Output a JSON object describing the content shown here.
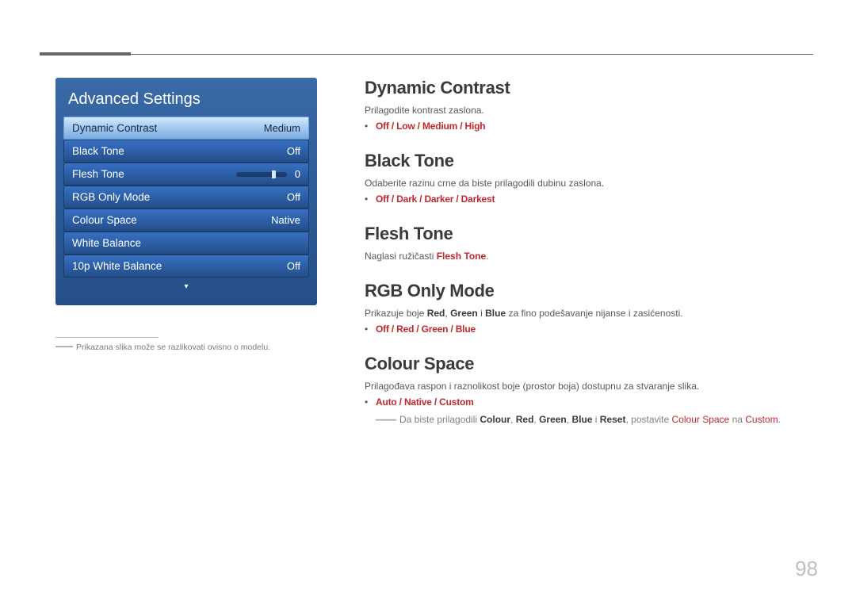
{
  "page_number": "98",
  "panel": {
    "title": "Advanced Settings",
    "items": [
      {
        "label": "Dynamic Contrast",
        "value": "Medium",
        "selected": true
      },
      {
        "label": "Black Tone",
        "value": "Off"
      },
      {
        "label": "Flesh Tone",
        "value": "0",
        "slider": true
      },
      {
        "label": "RGB Only Mode",
        "value": "Off"
      },
      {
        "label": "Colour Space",
        "value": "Native"
      },
      {
        "label": "White Balance",
        "value": ""
      },
      {
        "label": "10p White Balance",
        "value": "Off"
      }
    ]
  },
  "footnote": "Prikazana slika može se razlikovati ovisno o modelu.",
  "sections": {
    "dynamic_contrast": {
      "title": "Dynamic Contrast",
      "desc": "Prilagodite kontrast zaslona.",
      "options": [
        "Off",
        "Low",
        "Medium",
        "High"
      ]
    },
    "black_tone": {
      "title": "Black Tone",
      "desc": "Odaberite razinu crne da biste prilagodili dubinu zaslona.",
      "options": [
        "Off",
        "Dark",
        "Darker",
        "Darkest"
      ]
    },
    "flesh_tone": {
      "title": "Flesh Tone",
      "desc_pre": "Naglasi ružičasti ",
      "desc_red": "Flesh Tone",
      "desc_post": "."
    },
    "rgb_only": {
      "title": "RGB Only Mode",
      "desc_pre": "Prikazuje boje ",
      "r": "Red",
      "g": "Green",
      "b": "Blue",
      "comma": ", ",
      "i": " i ",
      "desc_post": " za fino podešavanje nijanse i zasićenosti.",
      "options": [
        "Off",
        "Red",
        "Green",
        "Blue"
      ]
    },
    "colour_space": {
      "title": "Colour Space",
      "desc": "Prilagođava raspon i raznolikost boje (prostor boja) dostupnu za stvaranje slika.",
      "options": [
        "Auto",
        "Native",
        "Custom"
      ],
      "note_pre": "Da biste prilagodili ",
      "note_bold": [
        "Colour",
        "Red",
        "Green",
        "Blue",
        "Reset"
      ],
      "note_mid": ", postavite ",
      "note_cs": "Colour Space",
      "note_na": " na ",
      "note_custom": "Custom",
      "note_end": "."
    }
  },
  "sep": " / "
}
